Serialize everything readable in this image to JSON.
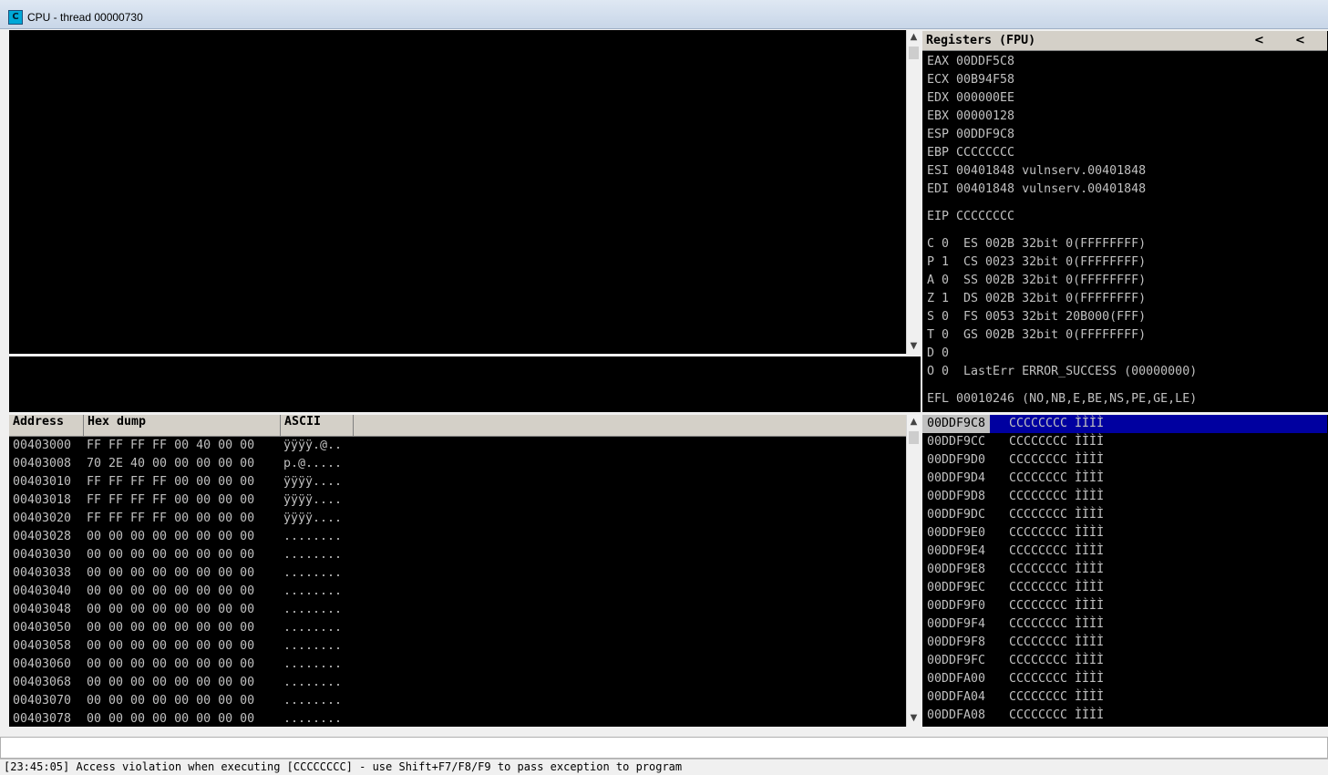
{
  "window": {
    "title": "CPU - thread 00000730",
    "icon_letter": "C"
  },
  "registers": {
    "header": "Registers (FPU)",
    "arrow_left": "<",
    "arrow_right": "<",
    "lines": [
      "EAX 00DDF5C8",
      "ECX 00B94F58",
      "EDX 000000EE",
      "EBX 00000128",
      "ESP 00DDF9C8",
      "EBP CCCCCCCC",
      "ESI 00401848 vulnserv.00401848",
      "EDI 00401848 vulnserv.00401848",
      "",
      "EIP CCCCCCCC",
      "",
      "C 0  ES 002B 32bit 0(FFFFFFFF)",
      "P 1  CS 0023 32bit 0(FFFFFFFF)",
      "A 0  SS 002B 32bit 0(FFFFFFFF)",
      "Z 1  DS 002B 32bit 0(FFFFFFFF)",
      "S 0  FS 0053 32bit 20B000(FFF)",
      "T 0  GS 002B 32bit 0(FFFFFFFF)",
      "D 0",
      "O 0  LastErr ERROR_SUCCESS (00000000)",
      "",
      "EFL 00010246 (NO,NB,E,BE,NS,PE,GE,LE)"
    ]
  },
  "dump": {
    "columns": {
      "address": "Address",
      "hex": "Hex dump",
      "ascii": "ASCII"
    },
    "rows": [
      {
        "address": "00403000",
        "hex": "FF FF FF FF 00 40 00 00",
        "ascii": "ÿÿÿÿ.@.."
      },
      {
        "address": "00403008",
        "hex": "70 2E 40 00 00 00 00 00",
        "ascii": "p.@....."
      },
      {
        "address": "00403010",
        "hex": "FF FF FF FF 00 00 00 00",
        "ascii": "ÿÿÿÿ...."
      },
      {
        "address": "00403018",
        "hex": "FF FF FF FF 00 00 00 00",
        "ascii": "ÿÿÿÿ...."
      },
      {
        "address": "00403020",
        "hex": "FF FF FF FF 00 00 00 00",
        "ascii": "ÿÿÿÿ...."
      },
      {
        "address": "00403028",
        "hex": "00 00 00 00 00 00 00 00",
        "ascii": "........"
      },
      {
        "address": "00403030",
        "hex": "00 00 00 00 00 00 00 00",
        "ascii": "........"
      },
      {
        "address": "00403038",
        "hex": "00 00 00 00 00 00 00 00",
        "ascii": "........"
      },
      {
        "address": "00403040",
        "hex": "00 00 00 00 00 00 00 00",
        "ascii": "........"
      },
      {
        "address": "00403048",
        "hex": "00 00 00 00 00 00 00 00",
        "ascii": "........"
      },
      {
        "address": "00403050",
        "hex": "00 00 00 00 00 00 00 00",
        "ascii": "........"
      },
      {
        "address": "00403058",
        "hex": "00 00 00 00 00 00 00 00",
        "ascii": "........"
      },
      {
        "address": "00403060",
        "hex": "00 00 00 00 00 00 00 00",
        "ascii": "........"
      },
      {
        "address": "00403068",
        "hex": "00 00 00 00 00 00 00 00",
        "ascii": "........"
      },
      {
        "address": "00403070",
        "hex": "00 00 00 00 00 00 00 00",
        "ascii": "........"
      },
      {
        "address": "00403078",
        "hex": "00 00 00 00 00 00 00 00",
        "ascii": "........"
      }
    ]
  },
  "stack": {
    "rows": [
      {
        "address": "00DDF9C8",
        "value": "CCCCCCCC ÌÌÌÌ",
        "selected": true
      },
      {
        "address": "00DDF9CC",
        "value": "CCCCCCCC ÌÌÌÌ"
      },
      {
        "address": "00DDF9D0",
        "value": "CCCCCCCC ÌÌÌÌ"
      },
      {
        "address": "00DDF9D4",
        "value": "CCCCCCCC ÌÌÌÌ"
      },
      {
        "address": "00DDF9D8",
        "value": "CCCCCCCC ÌÌÌÌ"
      },
      {
        "address": "00DDF9DC",
        "value": "CCCCCCCC ÌÌÌÌ"
      },
      {
        "address": "00DDF9E0",
        "value": "CCCCCCCC ÌÌÌÌ"
      },
      {
        "address": "00DDF9E4",
        "value": "CCCCCCCC ÌÌÌÌ"
      },
      {
        "address": "00DDF9E8",
        "value": "CCCCCCCC ÌÌÌÌ"
      },
      {
        "address": "00DDF9EC",
        "value": "CCCCCCCC ÌÌÌÌ"
      },
      {
        "address": "00DDF9F0",
        "value": "CCCCCCCC ÌÌÌÌ"
      },
      {
        "address": "00DDF9F4",
        "value": "CCCCCCCC ÌÌÌÌ"
      },
      {
        "address": "00DDF9F8",
        "value": "CCCCCCCC ÌÌÌÌ"
      },
      {
        "address": "00DDF9FC",
        "value": "CCCCCCCC ÌÌÌÌ"
      },
      {
        "address": "00DDFA00",
        "value": "CCCCCCCC ÌÌÌÌ"
      },
      {
        "address": "00DDFA04",
        "value": "CCCCCCCC ÌÌÌÌ"
      },
      {
        "address": "00DDFA08",
        "value": "CCCCCCCC ÌÌÌÌ"
      }
    ]
  },
  "command": {
    "value": ""
  },
  "status": {
    "text": "[23:45:05] Access violation when executing [CCCCCCCC] - use Shift+F7/F8/F9 to pass exception to program"
  },
  "scroll_arrows": {
    "up": "▲",
    "down": "▼"
  },
  "colors": {
    "panel_bg": "#000000",
    "text": "#c0c0c0",
    "selection": "#0000a0",
    "header_bg": "#d4d0c8"
  }
}
